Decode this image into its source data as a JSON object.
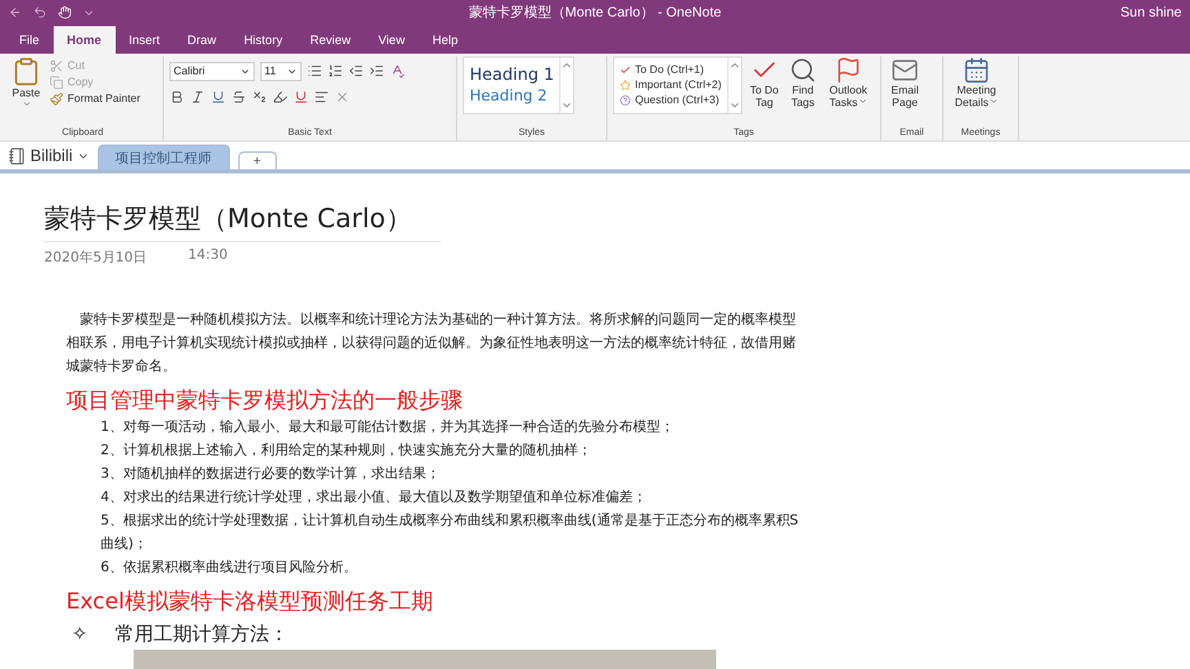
{
  "window": {
    "title": "蒙特卡罗模型（Monte Carlo） - OneNote",
    "user": "Sun shine"
  },
  "ribbon_tabs": [
    {
      "label": "File",
      "selected": false
    },
    {
      "label": "Home",
      "selected": true
    },
    {
      "label": "Insert",
      "selected": false
    },
    {
      "label": "Draw",
      "selected": false
    },
    {
      "label": "History",
      "selected": false
    },
    {
      "label": "Review",
      "selected": false
    },
    {
      "label": "View",
      "selected": false
    },
    {
      "label": "Help",
      "selected": false
    }
  ],
  "ribbon": {
    "clipboard": {
      "label": "Clipboard",
      "paste": "Paste",
      "items": [
        {
          "label": "Cut",
          "kind": "cut",
          "disabled": true
        },
        {
          "label": "Copy",
          "kind": "copy",
          "disabled": true
        },
        {
          "label": "Format Painter",
          "kind": "painter",
          "disabled": false
        }
      ]
    },
    "basic_text": {
      "label": "Basic Text",
      "font": "Calibri",
      "size": "11"
    },
    "styles": {
      "label": "Styles",
      "items": [
        "Heading 1",
        "Heading 2"
      ]
    },
    "tags": {
      "label": "Tags",
      "items": [
        {
          "label": "To Do (Ctrl+1)",
          "kind": "checkbox"
        },
        {
          "label": "Important (Ctrl+2)",
          "kind": "star"
        },
        {
          "label": "Question (Ctrl+3)",
          "kind": "question"
        }
      ],
      "buttons": [
        {
          "label": "To Do Tag",
          "kind": "todo",
          "menu": false
        },
        {
          "label": "Find Tags",
          "kind": "find",
          "menu": false
        },
        {
          "label": "Outlook Tasks",
          "kind": "flag",
          "menu": true
        }
      ]
    },
    "email": {
      "label": "Email",
      "button": "Email Page"
    },
    "meetings": {
      "label": "Meetings",
      "button": "Meeting Details"
    }
  },
  "notebook": {
    "name": "Bilibili",
    "sections": [
      {
        "label": "项目控制工程师",
        "selected": true
      }
    ],
    "add": "+"
  },
  "page": {
    "title": "蒙特卡罗模型（Monte Carlo）",
    "date": "2020年5月10日",
    "time": "14:30",
    "blocks": [
      {
        "kind": "paragraph",
        "text": "蒙特卡罗模型是一种随机模拟方法。以概率和统计理论方法为基础的一种计算方法。将所求解的问题同一定的概率模型相联系，用电子计算机实现统计模拟或抽样，以获得问题的近似解。为象征性地表明这一方法的概率统计特征，故借用赌城蒙特卡罗命名。"
      },
      {
        "kind": "heading",
        "text": "项目管理中蒙特卡罗模拟方法的一般步骤"
      },
      {
        "kind": "step",
        "text": "1、对每一项活动，输入最小、最大和最可能估计数据，并为其选择一种合适的先验分布模型；"
      },
      {
        "kind": "step",
        "text": "2、计算机根据上述输入，利用给定的某种规则，快速实施充分大量的随机抽样；"
      },
      {
        "kind": "step",
        "text": "3、对随机抽样的数据进行必要的数学计算，求出结果；"
      },
      {
        "kind": "step",
        "text": "4、对求出的结果进行统计学处理，求出最小值、最大值以及数学期望值和单位标准偏差；"
      },
      {
        "kind": "step",
        "text": "5、根据求出的统计学处理数据，让计算机自动生成概率分布曲线和累积概率曲线(通常是基于正态分布的概率累积S曲线)；"
      },
      {
        "kind": "step",
        "text": "6、依据累积概率曲线进行项目风险分析。"
      },
      {
        "kind": "heading",
        "text": "Excel模拟蒙特卡洛模型预测任务工期"
      },
      {
        "kind": "bullet",
        "marker": "✧",
        "text": "常用工期计算方法："
      },
      {
        "kind": "photo"
      }
    ]
  }
}
